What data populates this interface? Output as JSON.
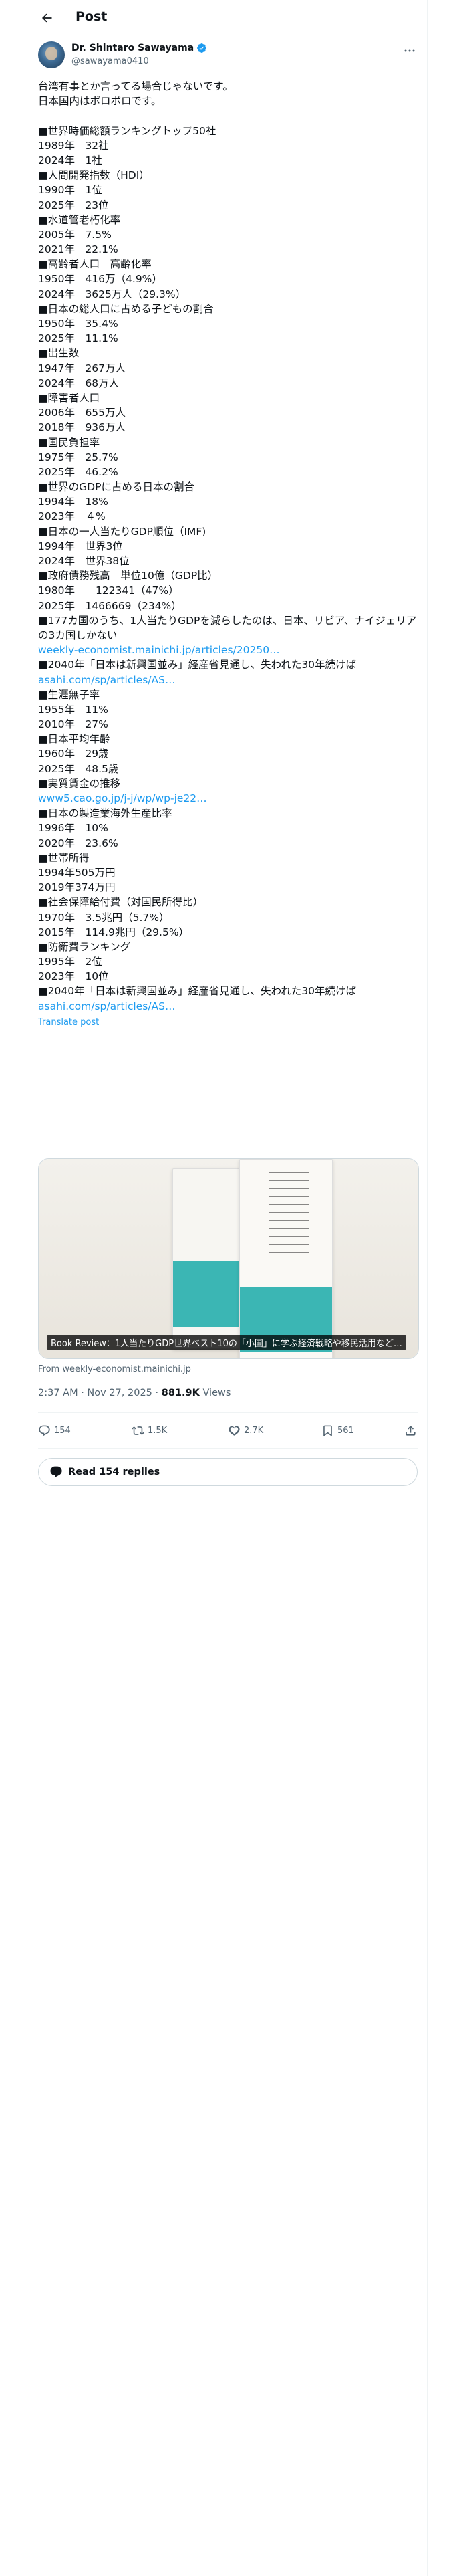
{
  "header": {
    "title": "Post"
  },
  "author": {
    "name": "Dr. Shintaro Sawayama",
    "handle": "@sawayama0410"
  },
  "post": {
    "lines": [
      {
        "text": "台湾有事とか言ってる場合じゃないです。"
      },
      {
        "text": "日本国内はボロボロです。"
      },
      {
        "text": " "
      },
      {
        "text": "■世界時価総額ランキングトップ50社"
      },
      {
        "text": "1989年　32社"
      },
      {
        "text": "2024年　1社"
      },
      {
        "text": "■人間開発指数（HDI）"
      },
      {
        "text": "1990年　1位"
      },
      {
        "text": "2025年　23位"
      },
      {
        "text": "■水道管老朽化率"
      },
      {
        "text": "2005年　7.5%"
      },
      {
        "text": "2021年　22.1%"
      },
      {
        "text": "■高齢者人口　高齢化率"
      },
      {
        "text": "1950年　416万（4.9%）"
      },
      {
        "text": "2024年　3625万人（29.3%）"
      },
      {
        "text": "■日本の総人口に占める子どもの割合"
      },
      {
        "text": "1950年　35.4%"
      },
      {
        "text": "2025年　11.1%"
      },
      {
        "text": "■出生数"
      },
      {
        "text": "1947年　267万人"
      },
      {
        "text": "2024年　68万人"
      },
      {
        "text": "■障害者人口"
      },
      {
        "text": "2006年　655万人"
      },
      {
        "text": "2018年　936万人"
      },
      {
        "text": "■国民負担率"
      },
      {
        "text": "1975年　25.7%"
      },
      {
        "text": "2025年　46.2%"
      },
      {
        "text": "■世界のGDPに占める日本の割合"
      },
      {
        "text": "1994年　18%"
      },
      {
        "text": "2023年　４%"
      },
      {
        "text": "■日本の一人当たりGDP順位（IMF)"
      },
      {
        "text": "1994年　世界3位"
      },
      {
        "text": "2024年　世界38位"
      },
      {
        "text": "■政府債務残高　単位10億（GDP比）"
      },
      {
        "text": "1980年　　122341（47%）"
      },
      {
        "text": "2025年　1466669（234%）"
      },
      {
        "text": "■177カ国のうち、1人当たりGDPを減らしたのは、日本、リビア、ナイジェリアの3カ国しかない",
        "wrap": true
      },
      {
        "text": "weekly-economist.mainichi.jp/articles/20250…",
        "link": true
      },
      {
        "text": "■2040年「日本は新興国並み」経産省見通し、失われた30年続けば"
      },
      {
        "text": "asahi.com/sp/articles/AS…",
        "link": true
      },
      {
        "text": "■生涯無子率"
      },
      {
        "text": "1955年　11%"
      },
      {
        "text": "2010年　27%"
      },
      {
        "text": "■日本平均年齢"
      },
      {
        "text": "1960年　29歳"
      },
      {
        "text": "2025年　48.5歳"
      },
      {
        "text": "■実質賃金の推移"
      },
      {
        "text": "www5.cao.go.jp/j-j/wp/wp-je22…",
        "link": true
      },
      {
        "text": "■日本の製造業海外生産比率"
      },
      {
        "text": "1996年　10%"
      },
      {
        "text": "2020年　23.6%"
      },
      {
        "text": "■世帯所得"
      },
      {
        "text": "1994年505万円"
      },
      {
        "text": "2019年374万円"
      },
      {
        "text": "■社会保障給付費（対国民所得比）"
      },
      {
        "text": "1970年　3.5兆円（5.7%）"
      },
      {
        "text": "2015年　114.9兆円（29.5%）"
      },
      {
        "text": "■防衛費ランキング"
      },
      {
        "text": "1995年　2位"
      },
      {
        "text": "2023年　10位"
      },
      {
        "text": "■2040年「日本は新興国並み」経産省見通し、失われた30年続けば"
      },
      {
        "text": "asahi.com/sp/articles/AS…",
        "link": true
      }
    ],
    "translate": "Translate post"
  },
  "card": {
    "caption": "Book Review：1人当たりGDP世界ベスト10の「小国」に学ぶ経済戦略や移民活用など…",
    "source": "From weekly-economist.mainichi.jp"
  },
  "meta": {
    "time": "2:37 AM · Nov 27, 2025 · ",
    "views_count": "881.9K",
    "views_label": " Views"
  },
  "actions": {
    "replies": "154",
    "reposts": "1.5K",
    "likes": "2.7K",
    "bookmarks": "561"
  },
  "read_replies": "Read 154 replies",
  "colors": {
    "link": "#1d9bf0",
    "text": "#0f1419",
    "muted": "#536471",
    "border": "#cfd9de",
    "accent_book": "#3bb6b4"
  }
}
